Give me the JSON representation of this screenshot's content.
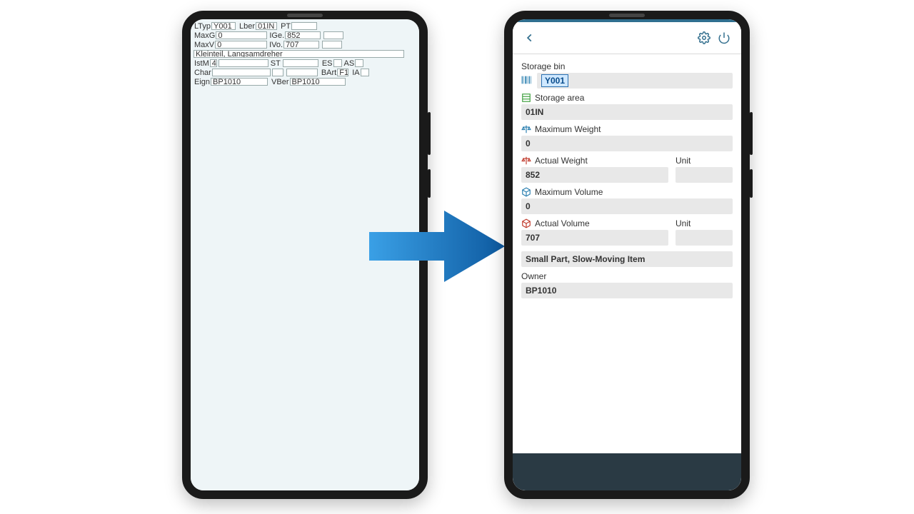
{
  "legacy": {
    "row1": {
      "l1": "LTyp",
      "v1": "Y001",
      "l2": "Lber",
      "v2": "01IN",
      "l3": "PT"
    },
    "row2": {
      "l1": "MaxG",
      "v1": "0",
      "l2": "IGe.",
      "v2": "852"
    },
    "row3": {
      "l1": "MaxV",
      "v1": "0",
      "l2": "IVo.",
      "v2": "707"
    },
    "row4": {
      "text": "Kleinteil, Langsamdreher"
    },
    "row5": {
      "l1": "IstM",
      "v1": "4",
      "l2": "ST",
      "l3": "ES",
      "l4": "AS"
    },
    "row6": {
      "l1": "Char",
      "l2": "BArt",
      "v2": "F1",
      "l3": "IA"
    },
    "row7": {
      "l1": "Eign",
      "v1": "BP1010",
      "l2": "VBer",
      "v2": "BP1010"
    }
  },
  "modern": {
    "storage_bin_label": "Storage bin",
    "storage_bin_value": "Y001",
    "storage_area_label": "Storage area",
    "storage_area_value": "01IN",
    "max_weight_label": "Maximum Weight",
    "max_weight_value": "0",
    "actual_weight_label": "Actual Weight",
    "actual_weight_value": "852",
    "unit_label": "Unit",
    "max_volume_label": "Maximum Volume",
    "max_volume_value": "0",
    "actual_volume_label": "Actual Volume",
    "actual_volume_value": "707",
    "description_value": "Small Part, Slow-Moving Item",
    "owner_label": "Owner",
    "owner_value": "BP1010"
  }
}
